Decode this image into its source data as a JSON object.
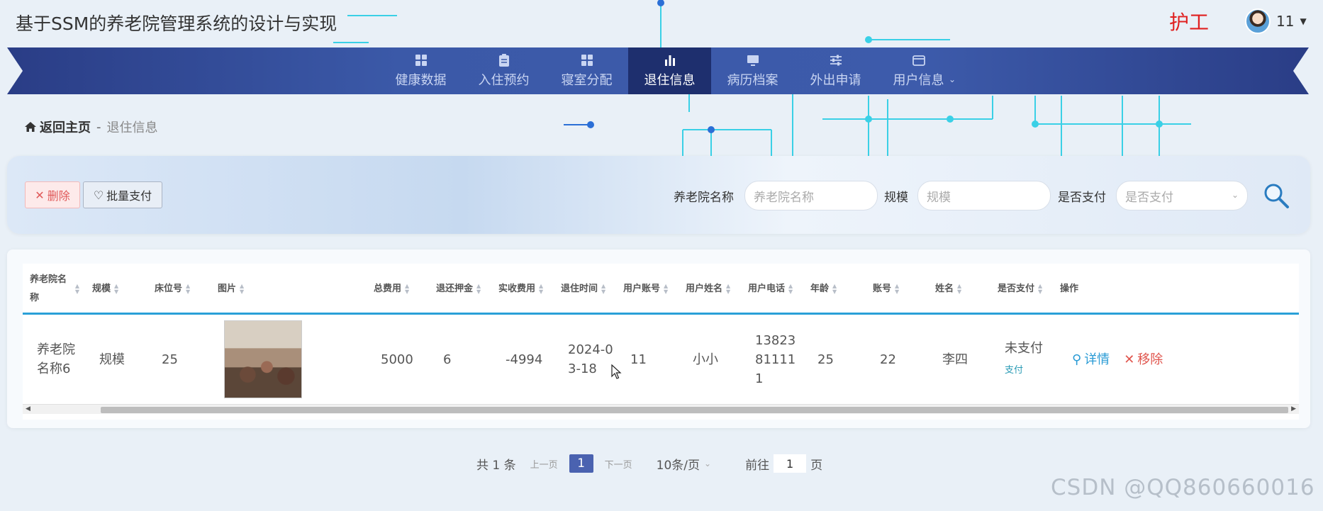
{
  "app": {
    "title": "基于SSM的养老院管理系统的设计与实现",
    "role": "护工"
  },
  "user": {
    "name": "11",
    "avatar_icon": "user-avatar"
  },
  "nav": {
    "items": [
      {
        "label": "健康数据",
        "icon": "grid-icon",
        "active": false
      },
      {
        "label": "入住预约",
        "icon": "clipboard-icon",
        "active": false
      },
      {
        "label": "寝室分配",
        "icon": "grid-icon",
        "active": false
      },
      {
        "label": "退住信息",
        "icon": "bar-chart-icon",
        "active": true
      },
      {
        "label": "病历档案",
        "icon": "monitor-icon",
        "active": false
      },
      {
        "label": "外出申请",
        "icon": "sliders-icon",
        "active": false
      },
      {
        "label": "用户信息",
        "icon": "card-icon",
        "active": false
      }
    ]
  },
  "breadcrumb": {
    "home": "返回主页",
    "separator": "-",
    "current": "退住信息"
  },
  "toolbar": {
    "delete_label": "删除",
    "batch_pay_label": "批量支付"
  },
  "search": {
    "name_label": "养老院名称",
    "name_placeholder": "养老院名称",
    "scale_label": "规模",
    "scale_placeholder": "规模",
    "paid_label": "是否支付",
    "paid_placeholder": "是否支付"
  },
  "table": {
    "headers": [
      "养老院名称",
      "规模",
      "床位号",
      "图片",
      "总费用",
      "退还押金",
      "实收费用",
      "退住时间",
      "用户账号",
      "用户姓名",
      "用户电话",
      "年龄",
      "账号",
      "姓名",
      "是否支付",
      "操作"
    ],
    "rows": [
      {
        "name": "养老院名称6",
        "scale": "规模",
        "bed": "25",
        "total": "5000",
        "deposit": "6",
        "actual": "-4994",
        "date": "2024-03-18",
        "account": "11",
        "username": "小小",
        "phone": "13823811111",
        "age": "25",
        "acct2": "22",
        "realname": "李四",
        "paid": "未支付",
        "pay_link": "支付",
        "detail": "详情",
        "remove": "移除"
      }
    ]
  },
  "pagination": {
    "total": "共 1 条",
    "prev": "上一页",
    "current": "1",
    "next": "下一页",
    "page_size": "10条/页",
    "goto_label": "前往",
    "goto_value": "1",
    "goto_suffix": "页"
  },
  "watermark": "CSDN @QQ860660016",
  "colors": {
    "nav_bg": "#3b59a8",
    "nav_active": "#1e2f6e",
    "accent": "#2aa0d8",
    "danger": "#e05a5a",
    "role": "#e02020"
  }
}
